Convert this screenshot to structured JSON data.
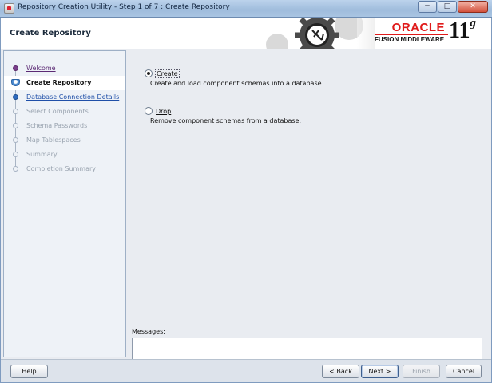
{
  "window": {
    "title": "Repository Creation Utility - Step 1 of 7 : Create Repository",
    "controls": {
      "minimize": "─",
      "maximize": "□",
      "close": "✕"
    }
  },
  "header": {
    "page_title": "Create Repository",
    "brand": {
      "oracle": "ORACLE",
      "product": "FUSION MIDDLEWARE",
      "version": "11",
      "version_suffix": "g",
      "brand_color": "#e01a1a"
    }
  },
  "nav": {
    "items": [
      {
        "label": "Welcome",
        "state": "visited"
      },
      {
        "label": "Create Repository",
        "state": "current"
      },
      {
        "label": "Database Connection Details",
        "state": "next"
      },
      {
        "label": "Select Components",
        "state": "disabled"
      },
      {
        "label": "Schema Passwords",
        "state": "disabled"
      },
      {
        "label": "Map Tablespaces",
        "state": "disabled"
      },
      {
        "label": "Summary",
        "state": "disabled"
      },
      {
        "label": "Completion Summary",
        "state": "disabled"
      }
    ]
  },
  "options": [
    {
      "label": "Create",
      "description": "Create and load component schemas into a database.",
      "selected": true
    },
    {
      "label": "Drop",
      "description": "Remove component schemas from a database.",
      "selected": false
    }
  ],
  "messages": {
    "label": "Messages:",
    "text": ""
  },
  "footer": {
    "help": "Help",
    "back": "< Back",
    "next": "Next >",
    "finish": "Finish",
    "cancel": "Cancel"
  }
}
